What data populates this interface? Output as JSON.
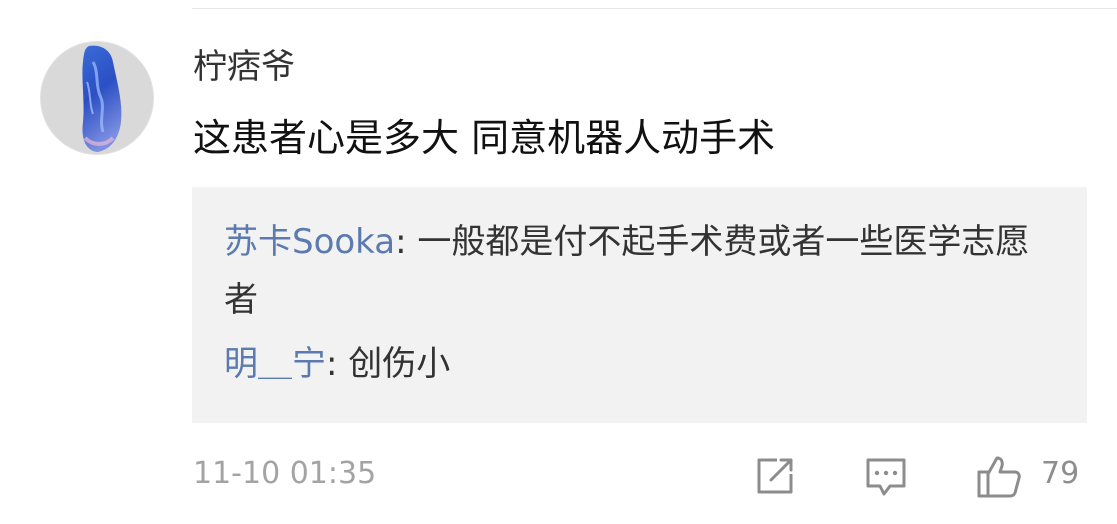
{
  "comment": {
    "username": "柠痞爷",
    "text": "这患者心是多大 同意机器人动手术",
    "timestamp": "11-10 01:35",
    "like_count": "79"
  },
  "replies": [
    {
      "author": "苏卡Sooka",
      "separator": ": ",
      "text": "一般都是付不起手术费或者一些医学志愿者"
    },
    {
      "author": "明＿宁",
      "separator": ": ",
      "text": "创伤小"
    }
  ],
  "actions": {
    "repost_icon": "share-square-icon",
    "comment_icon": "comment-bubble-icon",
    "like_icon": "thumbs-up-icon"
  },
  "colors": {
    "reply_author": "#5b7ab0",
    "reply_background": "#f2f2f2",
    "meta_text": "#a3a3a3"
  }
}
